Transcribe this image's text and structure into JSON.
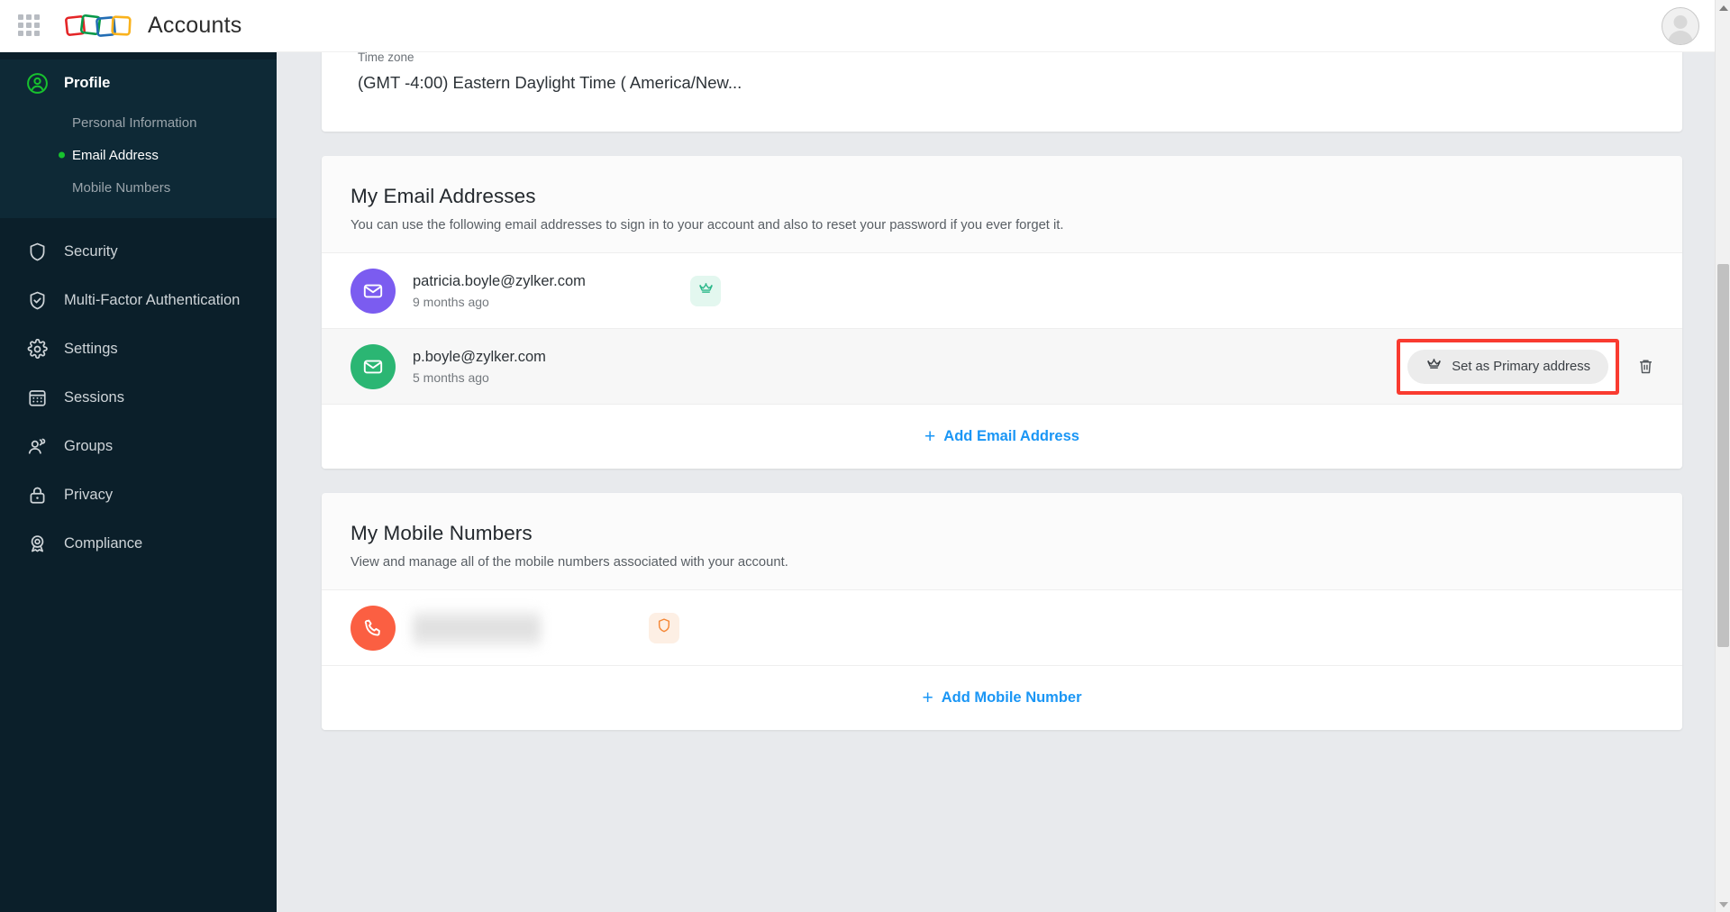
{
  "topbar": {
    "brand_title": "Accounts",
    "apps_grid_icon": "grid-apps-icon",
    "logo_icon": "zoho-squares-logo",
    "avatar_icon": "user-avatar"
  },
  "sidebar": {
    "profile": {
      "label": "Profile",
      "icon": "user-circle-icon"
    },
    "sub_items": [
      {
        "label": "Personal Information",
        "active": false
      },
      {
        "label": "Email Address",
        "active": true
      },
      {
        "label": "Mobile Numbers",
        "active": false
      }
    ],
    "items": [
      {
        "label": "Security",
        "icon": "shield-icon"
      },
      {
        "label": "Multi-Factor Authentication",
        "icon": "shield-check-icon"
      },
      {
        "label": "Settings",
        "icon": "gear-icon"
      },
      {
        "label": "Sessions",
        "icon": "calendar-grid-icon"
      },
      {
        "label": "Groups",
        "icon": "users-icon"
      },
      {
        "label": "Privacy",
        "icon": "lock-icon"
      },
      {
        "label": "Compliance",
        "icon": "award-badge-icon"
      }
    ]
  },
  "timezone_card": {
    "label": "Time zone",
    "value": "(GMT -4:00) Eastern Daylight Time ( America/New..."
  },
  "email_section": {
    "title": "My Email Addresses",
    "description": "You can use the following email addresses to sign in to your account and also to reset your password if you ever forget it.",
    "rows": [
      {
        "address": "patricia.boyle@zylker.com",
        "age": "9 months ago",
        "avatar_color": "#7b5cf0",
        "badge": "crown-icon",
        "badge_bg": "#e3f7ef",
        "badge_color": "#2bb88a",
        "is_primary": true
      },
      {
        "address": "p.boyle@zylker.com",
        "age": "5 months ago",
        "avatar_color": "#2bb673",
        "is_primary": false,
        "set_primary_label": "Set as Primary address",
        "set_primary_icon": "crown-icon",
        "delete_icon": "trash-icon",
        "highlight_color": "#f93b30"
      }
    ],
    "add_label": "Add Email Address",
    "add_icon": "plus-icon"
  },
  "mobile_section": {
    "title": "My Mobile Numbers",
    "description": "View and manage all of the mobile numbers associated with your account.",
    "rows": [
      {
        "number": "",
        "number_redacted": true,
        "avatar_color": "#fb5f42",
        "avatar_icon": "phone-icon",
        "badge": "shield-icon",
        "badge_bg": "#fdefe4",
        "badge_color": "#f58634"
      }
    ],
    "add_label": "Add Mobile Number",
    "add_icon": "plus-icon"
  },
  "scrollbar": {
    "up_icon": "caret-up-icon",
    "down_icon": "caret-down-icon"
  },
  "colors": {
    "accent_link": "#1a96f5",
    "sidebar_bg": "#0b1f2a",
    "active_green": "#17c22e",
    "highlight_red": "#f93b30"
  }
}
